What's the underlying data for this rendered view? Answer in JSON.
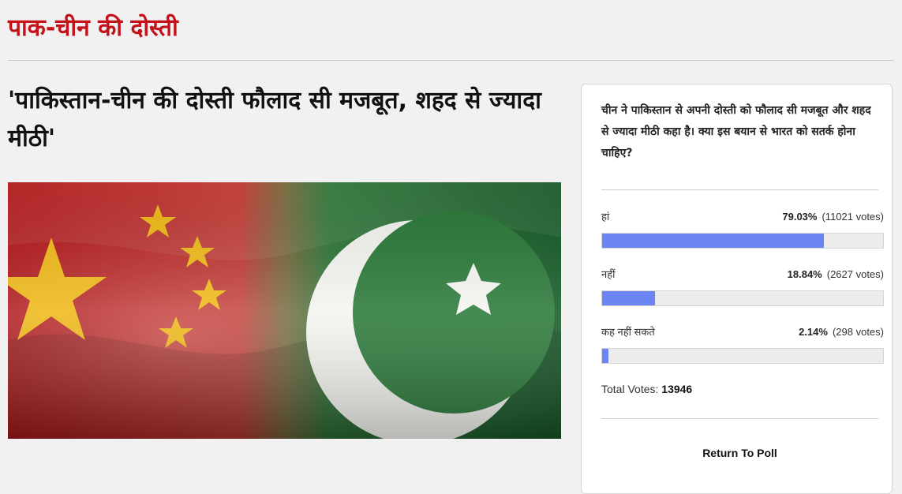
{
  "section_title": "पाक-चीन की दोस्ती",
  "headline": "'पाकिस्तान-चीन की दोस्ती फौलाद सी मजबूत, शहद से ज्यादा मीठी'",
  "image": {
    "icon": "china-pakistan-flags-image"
  },
  "poll": {
    "question": "चीन ने पाकिस्तान से अपनी दोस्ती को फौलाद सी मजबूत और शहद से ज्यादा मीठी कहा है। क्या इस बयान से भारत को सतर्क होना चाहिए?",
    "options": [
      {
        "label": "हां",
        "percent": "79.03%",
        "votes": "(11021 votes)",
        "fraction": 0.7903
      },
      {
        "label": "नहीं",
        "percent": "18.84%",
        "votes": "(2627 votes)",
        "fraction": 0.1884
      },
      {
        "label": "कह नहीं सकते",
        "percent": "2.14%",
        "votes": "(298 votes)",
        "fraction": 0.0214
      }
    ],
    "total_label": "Total Votes:",
    "total_value": "13946",
    "return_label": "Return To Poll",
    "bar_color": "#6b86f2"
  },
  "colors": {
    "title_red": "#c4121b"
  }
}
